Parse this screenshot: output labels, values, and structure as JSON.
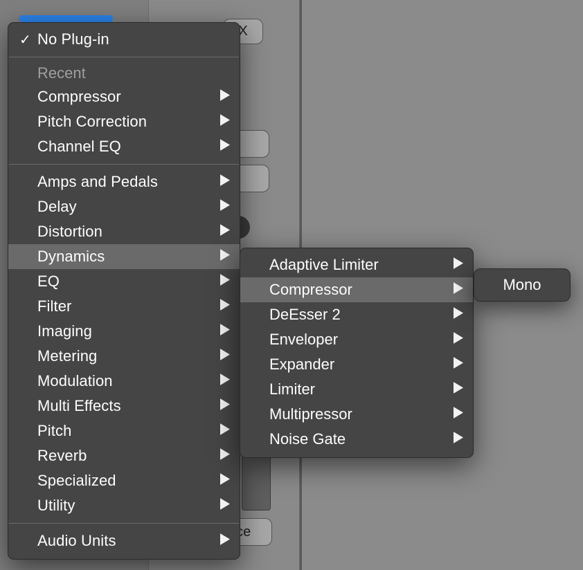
{
  "background": {
    "x_button": "X",
    "nce_fragment": "nce"
  },
  "menu": {
    "no_plugin": "No Plug-in",
    "recent_label": "Recent",
    "recent": [
      {
        "label": "Compressor"
      },
      {
        "label": "Pitch Correction"
      },
      {
        "label": "Channel EQ"
      }
    ],
    "categories": [
      {
        "label": "Amps and Pedals"
      },
      {
        "label": "Delay"
      },
      {
        "label": "Distortion"
      },
      {
        "label": "Dynamics",
        "highlight": true
      },
      {
        "label": "EQ"
      },
      {
        "label": "Filter"
      },
      {
        "label": "Imaging"
      },
      {
        "label": "Metering"
      },
      {
        "label": "Modulation"
      },
      {
        "label": "Multi Effects"
      },
      {
        "label": "Pitch"
      },
      {
        "label": "Reverb"
      },
      {
        "label": "Specialized"
      },
      {
        "label": "Utility"
      }
    ],
    "audio_units": "Audio Units"
  },
  "submenu": {
    "items": [
      {
        "label": "Adaptive Limiter"
      },
      {
        "label": "Compressor",
        "highlight": true
      },
      {
        "label": "DeEsser 2"
      },
      {
        "label": "Enveloper"
      },
      {
        "label": "Expander"
      },
      {
        "label": "Limiter"
      },
      {
        "label": "Multipressor"
      },
      {
        "label": "Noise Gate"
      }
    ]
  },
  "tertiary": {
    "mono": "Mono"
  }
}
